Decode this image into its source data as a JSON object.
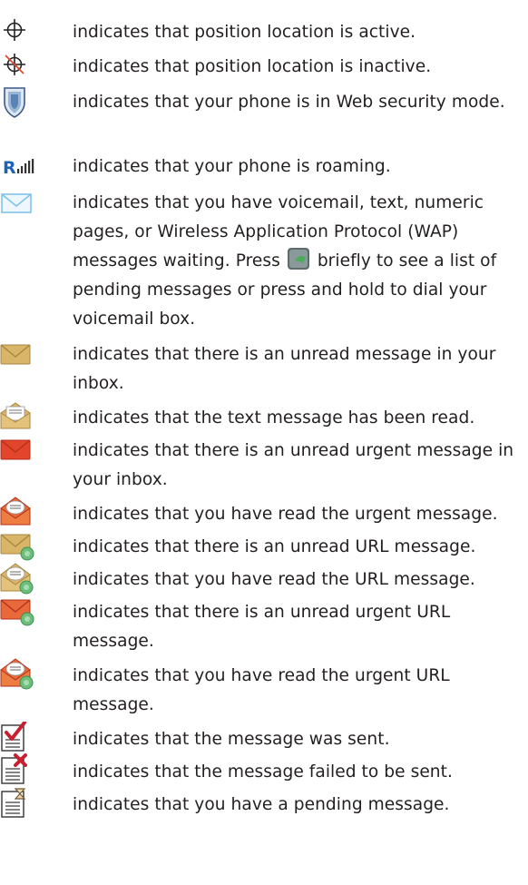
{
  "items": [
    {
      "icon": "position-location-active-icon",
      "text": "indicates that position location is active."
    },
    {
      "icon": "position-location-inactive-icon",
      "text": "indicates that position location is inactive."
    },
    {
      "icon": "web-security-shield-icon",
      "text": "indicates that your phone is in Web security mode."
    },
    {
      "icon": "roaming-icon",
      "text": "indicates that your phone is roaming."
    },
    {
      "icon": "messages-waiting-envelope-icon",
      "text_before": "indicates that you have voicemail, text, numeric pages, or Wireless Application Protocol (WAP) messages waiting. Press",
      "key_icon": "messaging-key-icon",
      "text_after": "briefly to see a list of pending messages or press and hold to dial your voicemail box."
    },
    {
      "icon": "unread-message-icon",
      "text": "indicates that there is an unread message in your inbox."
    },
    {
      "icon": "read-message-icon",
      "text": "indicates that the text message has been read."
    },
    {
      "icon": "unread-urgent-message-icon",
      "text": "indicates that there is an unread urgent message in your inbox."
    },
    {
      "icon": "read-urgent-message-icon",
      "text": "indicates that you have read the urgent message."
    },
    {
      "icon": "unread-url-message-icon",
      "text": "indicates that there is an unread URL message."
    },
    {
      "icon": "read-url-message-icon",
      "text": "indicates that you have read the URL message."
    },
    {
      "icon": "unread-urgent-url-message-icon",
      "text": "indicates that there is an unread urgent URL message."
    },
    {
      "icon": "read-urgent-url-message-icon",
      "text": "indicates that you have read the urgent URL message."
    },
    {
      "icon": "message-sent-icon",
      "text": "indicates that the message was sent."
    },
    {
      "icon": "message-failed-icon",
      "text": "indicates that the message failed to be sent."
    },
    {
      "icon": "message-pending-icon",
      "text": "indicates that you have a pending message."
    }
  ],
  "icon_labels": {
    "roaming_letter": "R"
  },
  "colors": {
    "text": "#231f20",
    "envelope_tan": "#c9a65a",
    "urgent_red": "#e2452b",
    "envelope_blue": "#7fc4ea",
    "url_green": "#6cbf7b",
    "check_red": "#c8202f",
    "roam_blue": "#1f62b3"
  }
}
